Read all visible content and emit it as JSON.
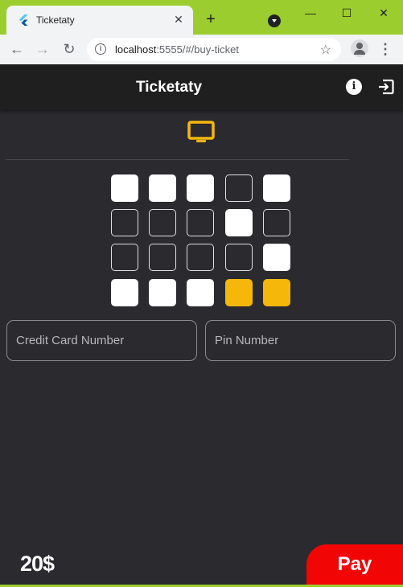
{
  "browser": {
    "tab_title": "Ticketaty",
    "tab_close": "✕",
    "new_tab": "+",
    "url_host": "localhost",
    "url_path": ":5555/#/buy-ticket",
    "window_minimize": "—",
    "window_maximize": "☐",
    "window_close": "✕"
  },
  "app": {
    "title": "Ticketaty",
    "info_icon_glyph": "i",
    "accent_color": "#f5b70a",
    "background_color": "#2a2a2f"
  },
  "seats": {
    "rows": [
      [
        "available",
        "available",
        "available",
        "taken",
        "available"
      ],
      [
        "taken",
        "taken",
        "taken",
        "available",
        "taken"
      ],
      [
        "taken",
        "taken",
        "taken",
        "taken",
        "available"
      ],
      [
        "available",
        "available",
        "available",
        "selected",
        "selected"
      ]
    ]
  },
  "form": {
    "credit_card_placeholder": "Credit Card Number",
    "credit_card_value": "",
    "pin_placeholder": "Pin Number",
    "pin_value": ""
  },
  "footer": {
    "price": "20$",
    "pay_label": "Pay",
    "pay_color": "#f20505"
  }
}
